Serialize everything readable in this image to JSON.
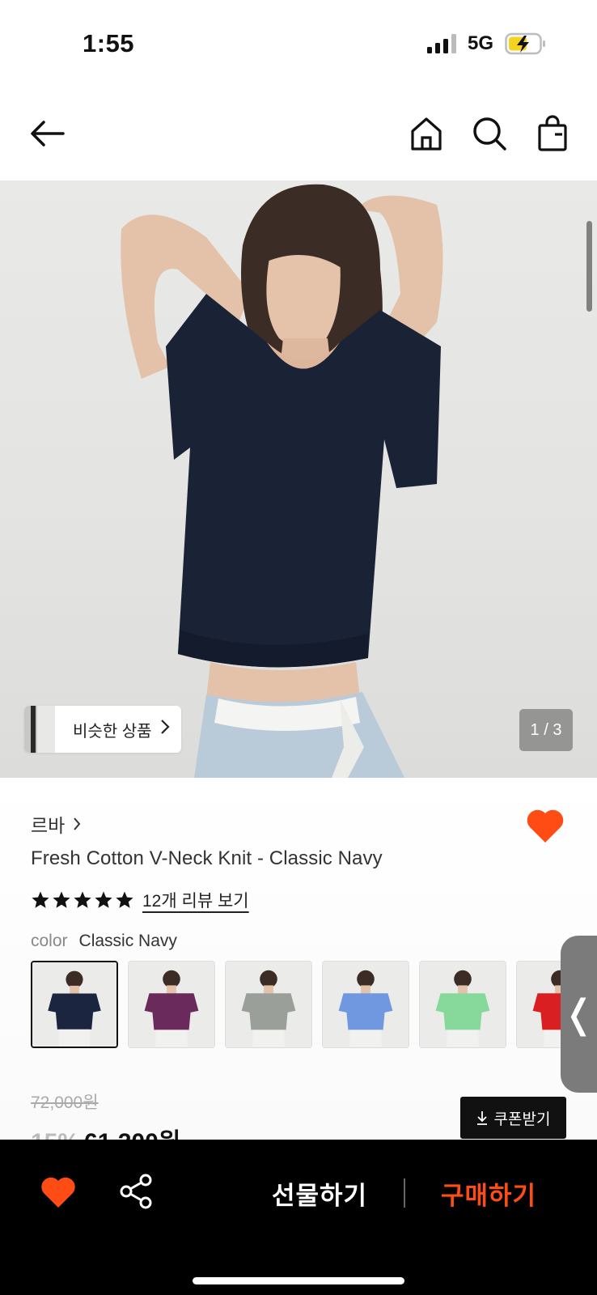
{
  "status_bar": {
    "time": "1:55",
    "network": "5G",
    "battery_level": 0.6,
    "charging": true
  },
  "nav": {
    "back_icon": "arrow-left-icon",
    "home_icon": "home-icon",
    "search_icon": "search-icon",
    "bag_icon": "shopping-bag-icon"
  },
  "gallery": {
    "similar_label": "비슷한 상품",
    "page_counter": "1 / 3"
  },
  "product": {
    "brand": "르바",
    "name": "Fresh Cotton V-Neck Knit - Classic Navy",
    "rating_stars": 5,
    "review_link": "12개 리뷰 보기",
    "color_key": "color",
    "color_value": "Classic Navy",
    "swatches": [
      {
        "color": "#1c2540"
      },
      {
        "color": "#6b2a5c"
      },
      {
        "color": "#9a9f99"
      },
      {
        "color": "#6f98e0"
      },
      {
        "color": "#86d99b"
      },
      {
        "color": "#d91f22"
      }
    ],
    "original_price": "72,000원",
    "discount_rate": "15%",
    "sale_price": "61,200원",
    "coupon_label": "쿠폰받기",
    "side_tab_glyph": "❬"
  },
  "bottom_bar": {
    "gift_label": "선물하기",
    "buy_label": "구매하기"
  },
  "colors": {
    "accent": "#ff4c14",
    "heart": "#ff4c14"
  }
}
